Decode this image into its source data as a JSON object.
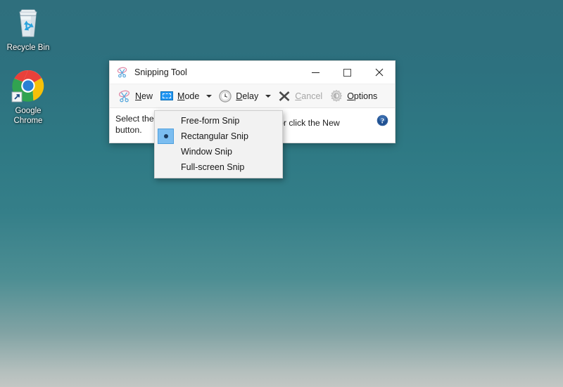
{
  "desktop": {
    "background_top_color": "#2f6f7d",
    "background_bottom_color": "#c3c7c4",
    "icons": [
      {
        "name": "recycle-bin",
        "label": "Recycle Bin",
        "icon": "recycle-bin-icon"
      },
      {
        "name": "google-chrome",
        "label": "Google\nChrome",
        "label_line1": "Google",
        "label_line2": "Chrome",
        "icon": "chrome-icon"
      }
    ]
  },
  "snipping_tool": {
    "title": "Snipping Tool",
    "title_icon": "snipping-tool-icon",
    "window_controls": {
      "minimize": "—",
      "maximize": "□",
      "close": "✕"
    },
    "toolbar": {
      "new": {
        "label": "New",
        "accel": "N",
        "icon": "scissors-icon",
        "enabled": true
      },
      "mode": {
        "label": "Mode",
        "accel": "M",
        "icon": "mode-rectangle-icon",
        "enabled": true,
        "has_dropdown": true
      },
      "delay": {
        "label": "Delay",
        "accel": "D",
        "icon": "clock-icon",
        "enabled": true,
        "has_dropdown": true
      },
      "cancel": {
        "label": "Cancel",
        "accel": "C",
        "icon": "x-icon",
        "enabled": false
      },
      "options": {
        "label": "Options",
        "accel": "O",
        "icon": "gear-icon",
        "enabled": true
      }
    },
    "body": {
      "text": "Select the button.",
      "text_line1": "Select the",
      "text_line2": "button.",
      "text_right": "or click the New",
      "help_icon": "help-question-icon"
    }
  },
  "mode_menu": {
    "selected": "Rectangular Snip",
    "items": [
      {
        "label": "Free-form Snip",
        "checked": false
      },
      {
        "label": "Rectangular Snip",
        "checked": true
      },
      {
        "label": "Window Snip",
        "checked": false
      },
      {
        "label": "Full-screen Snip",
        "checked": false
      }
    ]
  },
  "colors": {
    "accent_blue": "#2196f3",
    "menu_highlight": "#7bbdf0",
    "toolbar_bg": "#f7f7f7",
    "menu_bg": "#f2f2f2"
  }
}
